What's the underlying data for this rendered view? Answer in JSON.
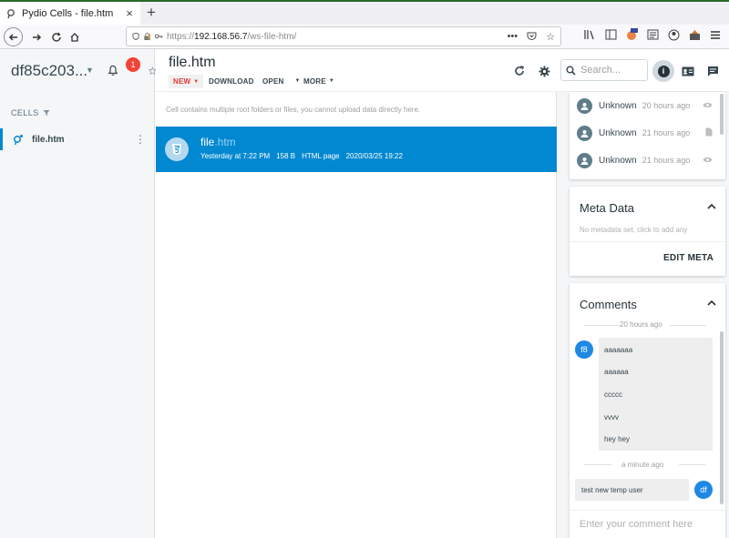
{
  "browser": {
    "tab_title": "Pydio Cells - file.htm",
    "tab_close": "×",
    "new_tab": "+",
    "url_prefix": "https://",
    "url_host": "192.168.56.7",
    "url_path": "/ws-file-htm/",
    "url_menu": "•••"
  },
  "sidebar": {
    "workspace_title": "df85c203...",
    "notification_count": "1",
    "cells_header": "CELLS",
    "items": [
      {
        "label": "file.htm"
      }
    ]
  },
  "header": {
    "title": "file.htm",
    "toolbar": {
      "new_label": "NEW",
      "download_label": "DOWNLOAD",
      "open_label": "OPEN",
      "more_label": "MORE"
    },
    "search_placeholder": "Search..."
  },
  "list": {
    "notice": "Cell contains multiple root folders or files, you cannot upload data directly here.",
    "rows": [
      {
        "name": "file",
        "ext": ".htm",
        "modified": "Yesterday at 7:22 PM",
        "size": "158 B",
        "type": "HTML page",
        "date": "2020/03/25 19:22"
      }
    ]
  },
  "activity": {
    "items": [
      {
        "who": "Unknown",
        "when": "20 hours ago",
        "icon": "eye-icon"
      },
      {
        "who": "Unknown",
        "when": "21 hours ago",
        "icon": "file-icon"
      },
      {
        "who": "Unknown",
        "when": "21 hours ago",
        "icon": "eye-icon"
      }
    ]
  },
  "meta": {
    "title": "Meta Data",
    "empty_text": "No metadata set, click to add any",
    "edit_label": "EDIT META"
  },
  "comments": {
    "title": "Comments",
    "day1": "20 hours ago",
    "author1_initials": "f8",
    "messages1": [
      "aaaaaaa",
      "aaaaaa",
      "ccccc",
      "vvvv",
      "hey hey"
    ],
    "day2": "a minute ago",
    "my_message": "test new temp user",
    "my_initials": "df",
    "input_placeholder": "Enter your comment here"
  },
  "colors": {
    "accent": "#0288d1",
    "badge": "#f44336",
    "new_label": "#e53935"
  }
}
